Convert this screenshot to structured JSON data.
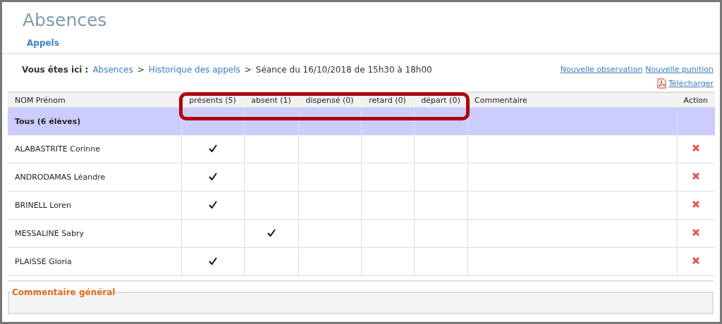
{
  "title": "Absences",
  "subtitle": "Appels",
  "breadcrumb": {
    "label": "Vous êtes ici :",
    "links": [
      "Absences",
      "Historique des appels"
    ],
    "separator": ">",
    "current": "Séance du 16/10/2018 de 15h30 à 18h00"
  },
  "actions": [
    "Nouvelle observation",
    "Nouvelle punition"
  ],
  "download": "Télécharger",
  "table": {
    "columns": [
      "NOM Prénom",
      "présents (5)",
      "absent (1)",
      "dispensé (0)",
      "retard (0)",
      "départ (0)",
      "Commentaire",
      "Action"
    ],
    "group_row": "Tous (6 élèves)",
    "rows": [
      {
        "name": "ALABASTRITE Corinne",
        "marks": [
          true,
          false,
          false,
          false,
          false
        ]
      },
      {
        "name": "ANDRODAMAS Léandre",
        "marks": [
          true,
          false,
          false,
          false,
          false
        ]
      },
      {
        "name": "BRINELL Loren",
        "marks": [
          true,
          false,
          false,
          false,
          false
        ]
      },
      {
        "name": "MESSALINE Sabry",
        "marks": [
          false,
          true,
          false,
          false,
          false
        ]
      },
      {
        "name": "PLAISSE Gloria",
        "marks": [
          true,
          false,
          false,
          false,
          false
        ]
      }
    ]
  },
  "highlight": true,
  "general_comment": {
    "legend": "Commentaire général"
  }
}
